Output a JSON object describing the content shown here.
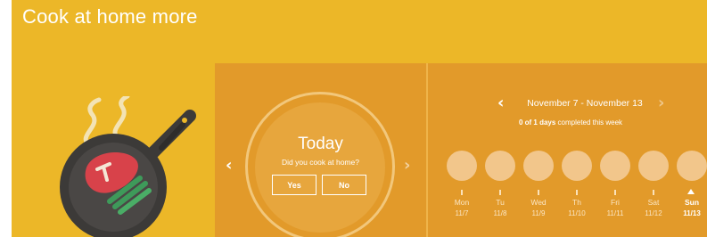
{
  "header": {
    "title": "Cook at home more"
  },
  "illustration": {
    "icon": "frying-pan-with-steak-icon"
  },
  "today": {
    "title": "Today",
    "question": "Did you cook at home?",
    "yes_label": "Yes",
    "no_label": "No",
    "prev_icon": "‹",
    "next_icon": "›"
  },
  "week": {
    "range": "November 7 - November 13",
    "completed": "0 of 1 days",
    "completed_suffix": "completed this week",
    "prev_icon": "‹",
    "next_icon": "›",
    "days": [
      {
        "name": "Mon",
        "date": "11/7"
      },
      {
        "name": "Tu",
        "date": "11/8"
      },
      {
        "name": "Wed",
        "date": "11/9"
      },
      {
        "name": "Th",
        "date": "11/10"
      },
      {
        "name": "Fri",
        "date": "11/11"
      },
      {
        "name": "Sat",
        "date": "11/12"
      },
      {
        "name": "Sun",
        "date": "11/13"
      }
    ]
  },
  "colors": {
    "background": "#ecb728",
    "panel": "#e29a2a",
    "day_circle": "#f2c68b",
    "pan": "#3c3a38",
    "steak": "#d8424a",
    "beans": "#3e9a5a"
  }
}
